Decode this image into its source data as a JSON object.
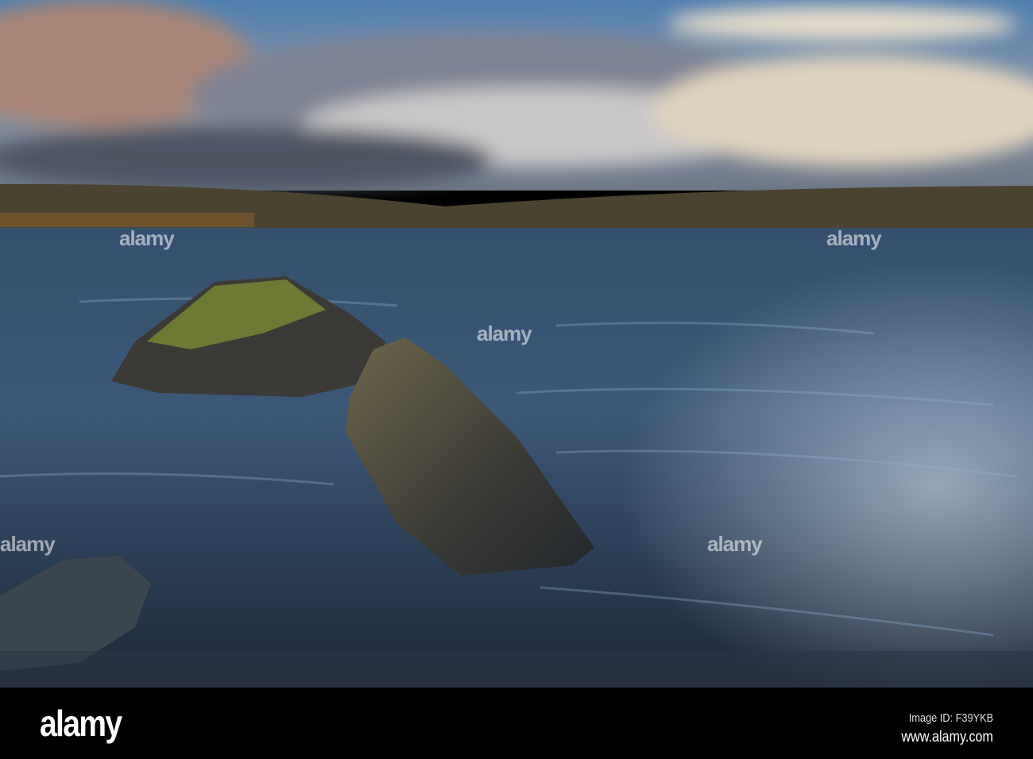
{
  "photo": {
    "subject": "lake-shore-rocks-landscape",
    "colors": {
      "sky_top": "#5a86b0",
      "cloud": "#c9c3c0",
      "hill": "#4a4330",
      "water": "#2e4660"
    }
  },
  "watermark": {
    "text": "alamy"
  },
  "footer": {
    "logo": "alamy",
    "image_id": "Image ID: F39YKB",
    "url": "www.alamy.com"
  }
}
